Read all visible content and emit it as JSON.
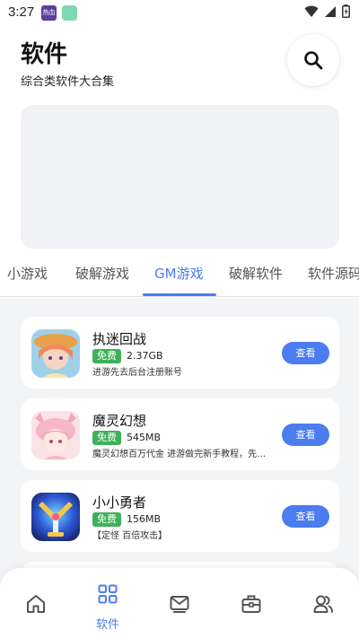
{
  "status_bar": {
    "time": "3:27",
    "app_icon_text": "热血"
  },
  "header": {
    "title": "软件",
    "subtitle": "综合类软件大合集"
  },
  "tabs": [
    {
      "label": "小游戏"
    },
    {
      "label": "破解游戏"
    },
    {
      "label": "GM游戏",
      "active": true
    },
    {
      "label": "破解软件"
    },
    {
      "label": "软件源码"
    }
  ],
  "apps": [
    {
      "name": "执迷回战",
      "badge": "免费",
      "size": "2.37GB",
      "description": "进游先去后台注册账号",
      "button": "查看"
    },
    {
      "name": "魔灵幻想",
      "badge": "免费",
      "size": "545MB",
      "description": "魔灵幻想百万代金 进游做完新手教程，先…",
      "button": "查看"
    },
    {
      "name": "小小勇者",
      "badge": "免费",
      "size": "156MB",
      "description": "【定怪 百倍攻击】",
      "button": "查看"
    }
  ],
  "bottom_nav": [
    {
      "icon": "home-icon"
    },
    {
      "icon": "grid-icon",
      "label": "软件",
      "active": true
    },
    {
      "icon": "mail-icon"
    },
    {
      "icon": "toolbox-icon"
    },
    {
      "icon": "users-icon"
    }
  ],
  "colors": {
    "accent": "#4b7cf0",
    "badge": "#3fb05a",
    "content_bg": "#f3f4f6"
  }
}
